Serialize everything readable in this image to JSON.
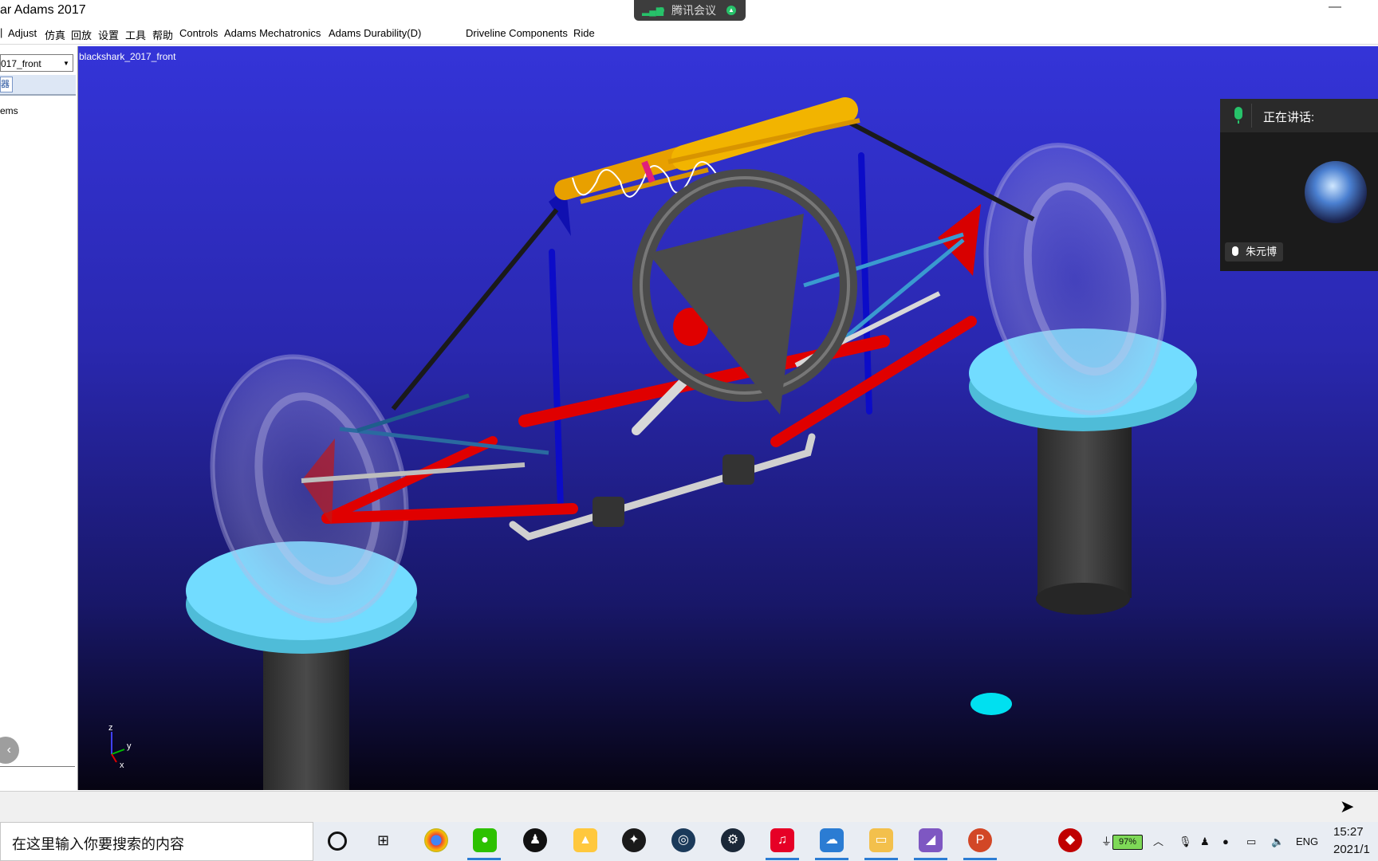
{
  "window": {
    "title": "ar Adams 2017",
    "minimize_glyph": "—"
  },
  "meeting_bar": {
    "label": "腾讯会议",
    "signal_icon": "signal-bars-icon"
  },
  "menubar": {
    "items": [
      "Adjust",
      "仿真",
      "回放",
      "设置",
      "工具",
      "帮助",
      "Controls",
      "Adams Mechatronics",
      "Adams Durability(D)",
      "Driveline Components",
      "Ride"
    ]
  },
  "left_panel": {
    "model_select_value": "017_front",
    "tab_label": "器",
    "tree_item": "ems",
    "collapse_glyph": "‹"
  },
  "viewport": {
    "model_name": "blackshark_2017_front",
    "triad": {
      "z": "z",
      "y": "y",
      "x": "x"
    },
    "colors": {
      "bg_top": "#3434d8",
      "bg_bottom": "#060412",
      "arm_red": "#e00000",
      "rod_blue": "#0a0ac8",
      "damper": "#e8a000",
      "pad": "#70dcff"
    }
  },
  "meeting_panel": {
    "speaking_label": "正在讲话:",
    "participant_name": "朱元博"
  },
  "taskbar": {
    "search_placeholder": "在这里输入你要搜索的内容",
    "battery": "97%",
    "language": "ENG",
    "time": "15:27",
    "date": "2021/1"
  },
  "icons": [
    "chrome-icon",
    "wechat-icon",
    "qq-icon",
    "photos-icon",
    "app-icon",
    "steam-icon",
    "netease-music-icon",
    "baidu-netdisk-icon",
    "file-explorer-icon",
    "visual-studio-icon",
    "powerpoint-icon"
  ]
}
